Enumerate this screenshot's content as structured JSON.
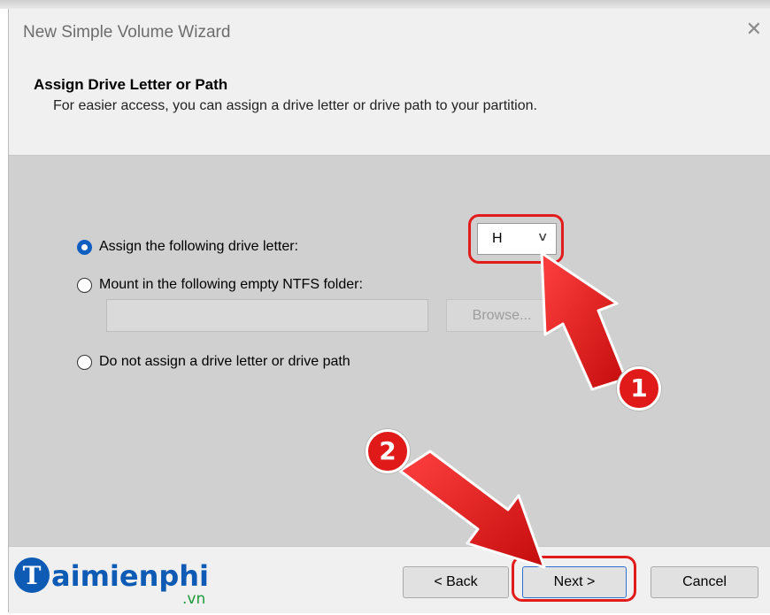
{
  "window": {
    "title": "New Simple Volume Wizard",
    "close_glyph": "✕"
  },
  "header": {
    "title": "Assign Drive Letter or Path",
    "subtitle": "For easier access, you can assign a drive letter or drive path to your partition."
  },
  "options": {
    "assign_letter": {
      "label": "Assign the following drive letter:",
      "checked": true
    },
    "mount_folder": {
      "label": "Mount in the following empty NTFS folder:",
      "checked": false
    },
    "no_assign": {
      "label": "Do not assign a drive letter or drive path",
      "checked": false
    }
  },
  "drive_select": {
    "value": "H",
    "icon": "chevron-down-icon"
  },
  "folder_input": {
    "value": ""
  },
  "browse_label": "Browse...",
  "buttons": {
    "back": "< Back",
    "next": "Next >",
    "cancel": "Cancel"
  },
  "annotations": {
    "step1": "1",
    "step2": "2"
  },
  "logo": {
    "brand": "aimienphi",
    "initial": "T",
    "suffix": ".vn"
  },
  "colors": {
    "accent_radio": "#0f5fc0",
    "annotation_red": "#e21b1b",
    "content_bg": "#d0d0d0",
    "logo_blue": "#0d5bb5"
  }
}
